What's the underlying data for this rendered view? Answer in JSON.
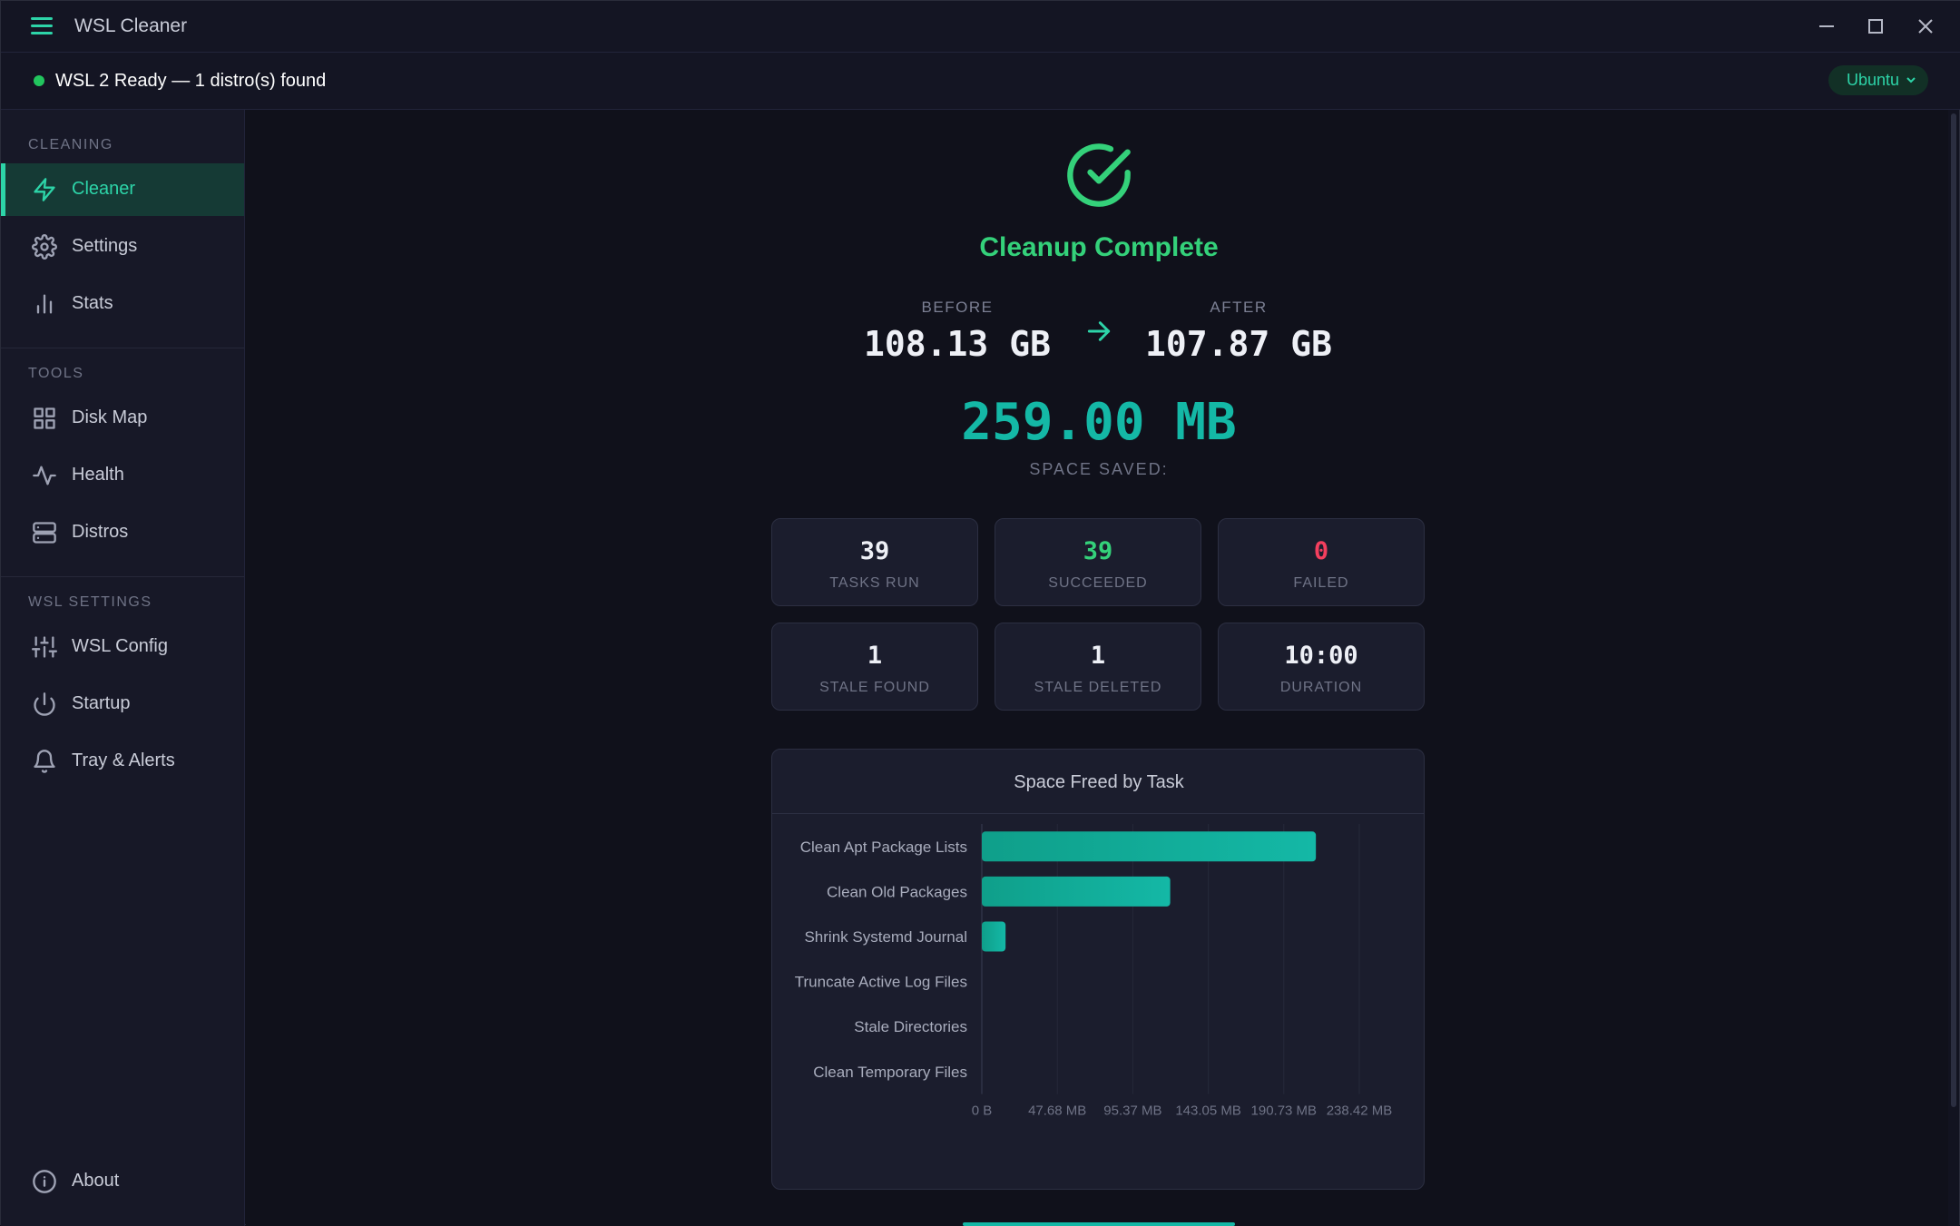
{
  "app": {
    "title": "WSL Cleaner"
  },
  "status": {
    "text": "WSL 2 Ready — 1 distro(s) found",
    "distro": "Ubuntu"
  },
  "sidebar": {
    "sections": [
      {
        "label": "CLEANING",
        "items": [
          {
            "label": "Cleaner",
            "icon": "lightning-icon",
            "active": true
          },
          {
            "label": "Settings",
            "icon": "gear-icon"
          },
          {
            "label": "Stats",
            "icon": "bar-chart-icon"
          }
        ]
      },
      {
        "label": "TOOLS",
        "items": [
          {
            "label": "Disk Map",
            "icon": "grid-icon"
          },
          {
            "label": "Health",
            "icon": "pulse-icon"
          },
          {
            "label": "Distros",
            "icon": "server-icon"
          }
        ]
      },
      {
        "label": "WSL SETTINGS",
        "items": [
          {
            "label": "WSL Config",
            "icon": "sliders-icon"
          },
          {
            "label": "Startup",
            "icon": "power-icon"
          },
          {
            "label": "Tray & Alerts",
            "icon": "bell-icon"
          }
        ]
      }
    ],
    "about": {
      "label": "About",
      "icon": "info-icon"
    }
  },
  "result": {
    "title": "Cleanup Complete",
    "before_label": "BEFORE",
    "before_value": "108.13 GB",
    "after_label": "AFTER",
    "after_value": "107.87 GB",
    "saved_value": "259.00 MB",
    "saved_label": "SPACE SAVED:"
  },
  "stats": [
    {
      "value": "39",
      "label": "TASKS RUN",
      "color": "#eef0f6"
    },
    {
      "value": "39",
      "label": "SUCCEEDED",
      "color": "#34d17a"
    },
    {
      "value": "0",
      "label": "FAILED",
      "color": "#f43f5e"
    },
    {
      "value": "1",
      "label": "STALE FOUND",
      "color": "#eef0f6"
    },
    {
      "value": "1",
      "label": "STALE DELETED",
      "color": "#eef0f6"
    },
    {
      "value": "10:00",
      "label": "DURATION",
      "color": "#eef0f6"
    }
  ],
  "colors": {
    "accent": "#2dd4a8",
    "success": "#34d17a",
    "danger": "#f43f5e",
    "bar": "#14b8a6"
  },
  "chart_data": {
    "type": "bar",
    "orientation": "horizontal",
    "title": "Space Freed by Task",
    "categories": [
      "Clean Apt Package Lists",
      "Clean Old Packages",
      "Shrink Systemd Journal",
      "Truncate Active Log Files",
      "Stale Directories",
      "Clean Temporary Files"
    ],
    "values_mb": [
      211,
      119,
      15,
      0,
      0,
      0
    ],
    "xlim_mb": [
      0,
      238.42
    ],
    "x_ticks_mb": [
      0,
      47.68,
      95.37,
      143.05,
      190.73,
      238.42
    ],
    "x_tick_labels": [
      "0 B",
      "47.68 MB",
      "95.37 MB",
      "143.05 MB",
      "190.73 MB",
      "238.42 MB"
    ],
    "grid": true
  }
}
